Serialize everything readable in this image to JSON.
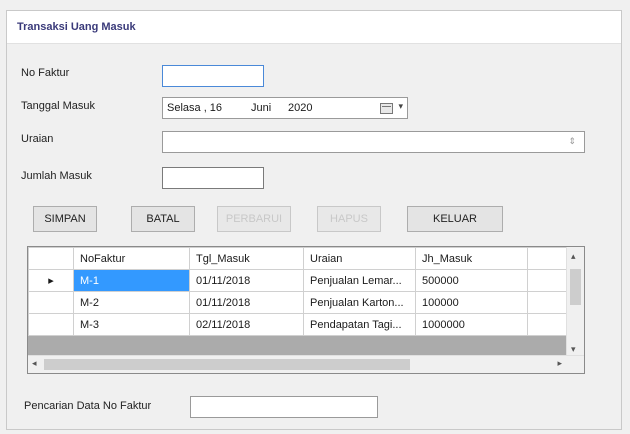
{
  "window": {
    "title": "Transaksi Uang Masuk"
  },
  "form": {
    "no_faktur_label": "No Faktur",
    "tanggal_label": "Tanggal Masuk",
    "tanggal_day": "Selasa , 16",
    "tanggal_month": "Juni",
    "tanggal_year": "2020",
    "uraian_label": "Uraian",
    "jumlah_label": "Jumlah Masuk"
  },
  "buttons": {
    "simpan": "SIMPAN",
    "batal": "BATAL",
    "perbarui": "PERBARUI",
    "hapus": "HAPUS",
    "keluar": "KELUAR"
  },
  "grid": {
    "columns": [
      "NoFaktur",
      "Tgl_Masuk",
      "Uraian",
      "Jh_Masuk"
    ],
    "rows": [
      {
        "marker": "▸",
        "cells": [
          "M-1",
          "01/11/2018",
          "Penjualan Lemar...",
          "500000"
        ]
      },
      {
        "marker": "",
        "cells": [
          "M-2",
          "01/11/2018",
          "Penjualan Karton...",
          "100000"
        ]
      },
      {
        "marker": "",
        "cells": [
          "M-3",
          "02/11/2018",
          "Pendapatan Tagi...",
          "1000000"
        ]
      }
    ]
  },
  "search": {
    "label": "Pencarian Data No Faktur"
  },
  "icons": {
    "calendar": "calendar-icon",
    "dropdown": "chevron-down-icon"
  }
}
